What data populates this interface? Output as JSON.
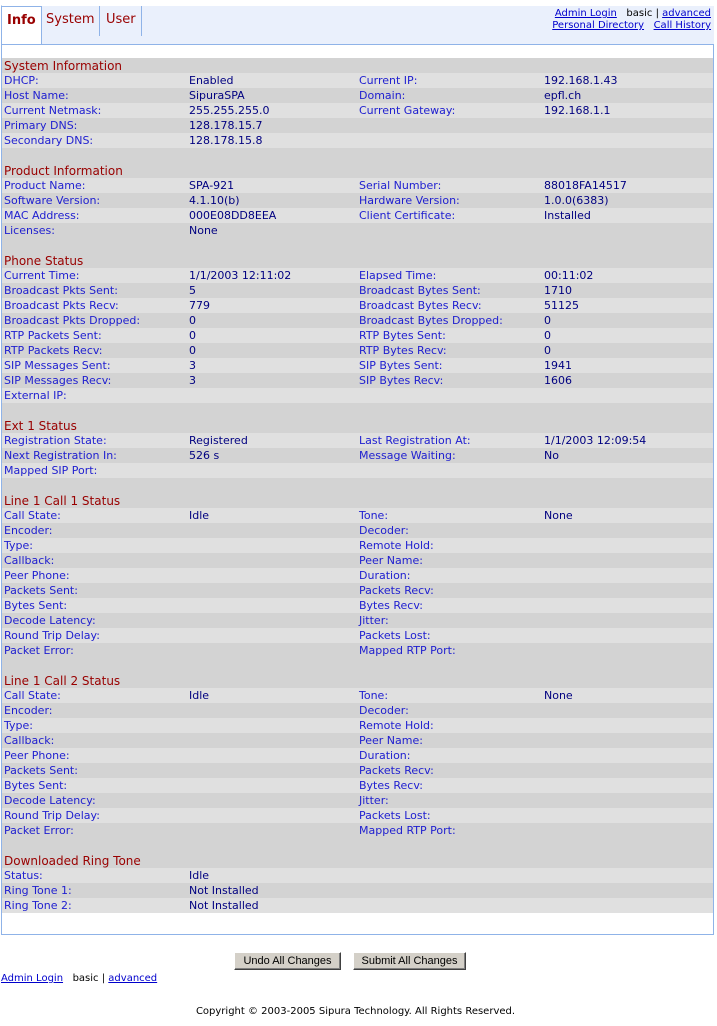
{
  "tabs": [
    {
      "label": "Info",
      "active": true
    },
    {
      "label": "System",
      "active": false
    },
    {
      "label": "User",
      "active": false
    }
  ],
  "top_links": {
    "admin_login": "Admin Login",
    "basic": "basic",
    "separator": "|",
    "advanced": "advanced",
    "personal_directory": "Personal Directory",
    "call_history": "Call History"
  },
  "sections": [
    {
      "title": "System Information",
      "rows": [
        [
          "DHCP:",
          "Enabled",
          "Current IP:",
          "192.168.1.43"
        ],
        [
          "Host Name:",
          "SipuraSPA",
          "Domain:",
          "epfl.ch"
        ],
        [
          "Current Netmask:",
          "255.255.255.0",
          "Current Gateway:",
          "192.168.1.1"
        ],
        [
          "Primary DNS:",
          "128.178.15.7",
          "",
          ""
        ],
        [
          "Secondary DNS:",
          "128.178.15.8",
          "",
          ""
        ]
      ]
    },
    {
      "title": "Product Information",
      "rows": [
        [
          "Product Name:",
          "SPA-921",
          "Serial Number:",
          "88018FA14517"
        ],
        [
          "Software Version:",
          "4.1.10(b)",
          "Hardware Version:",
          "1.0.0(6383)"
        ],
        [
          "MAC Address:",
          "000E08DD8EEA",
          "Client Certificate:",
          "Installed"
        ],
        [
          "Licenses:",
          "None",
          "",
          ""
        ]
      ]
    },
    {
      "title": "Phone Status",
      "rows": [
        [
          "Current Time:",
          "1/1/2003 12:11:02",
          "Elapsed Time:",
          "00:11:02"
        ],
        [
          "Broadcast Pkts Sent:",
          "5",
          "Broadcast Bytes Sent:",
          "1710"
        ],
        [
          "Broadcast Pkts Recv:",
          "779",
          "Broadcast Bytes Recv:",
          "51125"
        ],
        [
          "Broadcast Pkts Dropped:",
          "0",
          "Broadcast Bytes Dropped:",
          "0"
        ],
        [
          "RTP Packets Sent:",
          "0",
          "RTP Bytes Sent:",
          "0"
        ],
        [
          "RTP Packets Recv:",
          "0",
          "RTP Bytes Recv:",
          "0"
        ],
        [
          "SIP Messages Sent:",
          "3",
          "SIP Bytes Sent:",
          "1941"
        ],
        [
          "SIP Messages Recv:",
          "3",
          "SIP Bytes Recv:",
          "1606"
        ],
        [
          "External IP:",
          "",
          "",
          ""
        ]
      ]
    },
    {
      "title": "Ext 1 Status",
      "rows": [
        [
          "Registration State:",
          "Registered",
          "Last Registration At:",
          "1/1/2003 12:09:54"
        ],
        [
          "Next Registration In:",
          "526 s",
          "Message Waiting:",
          "No"
        ],
        [
          "Mapped SIP Port:",
          "",
          "",
          ""
        ]
      ]
    },
    {
      "title": "Line 1 Call 1 Status",
      "rows": [
        [
          "Call State:",
          "Idle",
          "Tone:",
          "None"
        ],
        [
          "Encoder:",
          "",
          "Decoder:",
          ""
        ],
        [
          "Type:",
          "",
          "Remote Hold:",
          ""
        ],
        [
          "Callback:",
          "",
          "Peer Name:",
          ""
        ],
        [
          "Peer Phone:",
          "",
          "Duration:",
          ""
        ],
        [
          "Packets Sent:",
          "",
          "Packets Recv:",
          ""
        ],
        [
          "Bytes Sent:",
          "",
          "Bytes Recv:",
          ""
        ],
        [
          "Decode Latency:",
          "",
          "Jitter:",
          ""
        ],
        [
          "Round Trip Delay:",
          "",
          "Packets Lost:",
          ""
        ],
        [
          "Packet Error:",
          "",
          "Mapped RTP Port:",
          ""
        ]
      ]
    },
    {
      "title": "Line 1 Call 2 Status",
      "rows": [
        [
          "Call State:",
          "Idle",
          "Tone:",
          "None"
        ],
        [
          "Encoder:",
          "",
          "Decoder:",
          ""
        ],
        [
          "Type:",
          "",
          "Remote Hold:",
          ""
        ],
        [
          "Callback:",
          "",
          "Peer Name:",
          ""
        ],
        [
          "Peer Phone:",
          "",
          "Duration:",
          ""
        ],
        [
          "Packets Sent:",
          "",
          "Packets Recv:",
          ""
        ],
        [
          "Bytes Sent:",
          "",
          "Bytes Recv:",
          ""
        ],
        [
          "Decode Latency:",
          "",
          "Jitter:",
          ""
        ],
        [
          "Round Trip Delay:",
          "",
          "Packets Lost:",
          ""
        ],
        [
          "Packet Error:",
          "",
          "Mapped RTP Port:",
          ""
        ]
      ]
    },
    {
      "title": "Downloaded Ring Tone",
      "rows": [
        [
          "Status:",
          "Idle",
          "",
          ""
        ],
        [
          "Ring Tone 1:",
          "Not Installed",
          "",
          ""
        ],
        [
          "Ring Tone 2:",
          "Not Installed",
          "",
          ""
        ]
      ]
    }
  ],
  "buttons": {
    "undo": "Undo All Changes",
    "submit": "Submit All Changes"
  },
  "bottom_links": {
    "admin_login": "Admin Login",
    "basic": "basic",
    "separator": "|",
    "advanced": "advanced"
  },
  "copyright": "Copyright © 2003-2005 Sipura Technology. All Rights Reserved."
}
